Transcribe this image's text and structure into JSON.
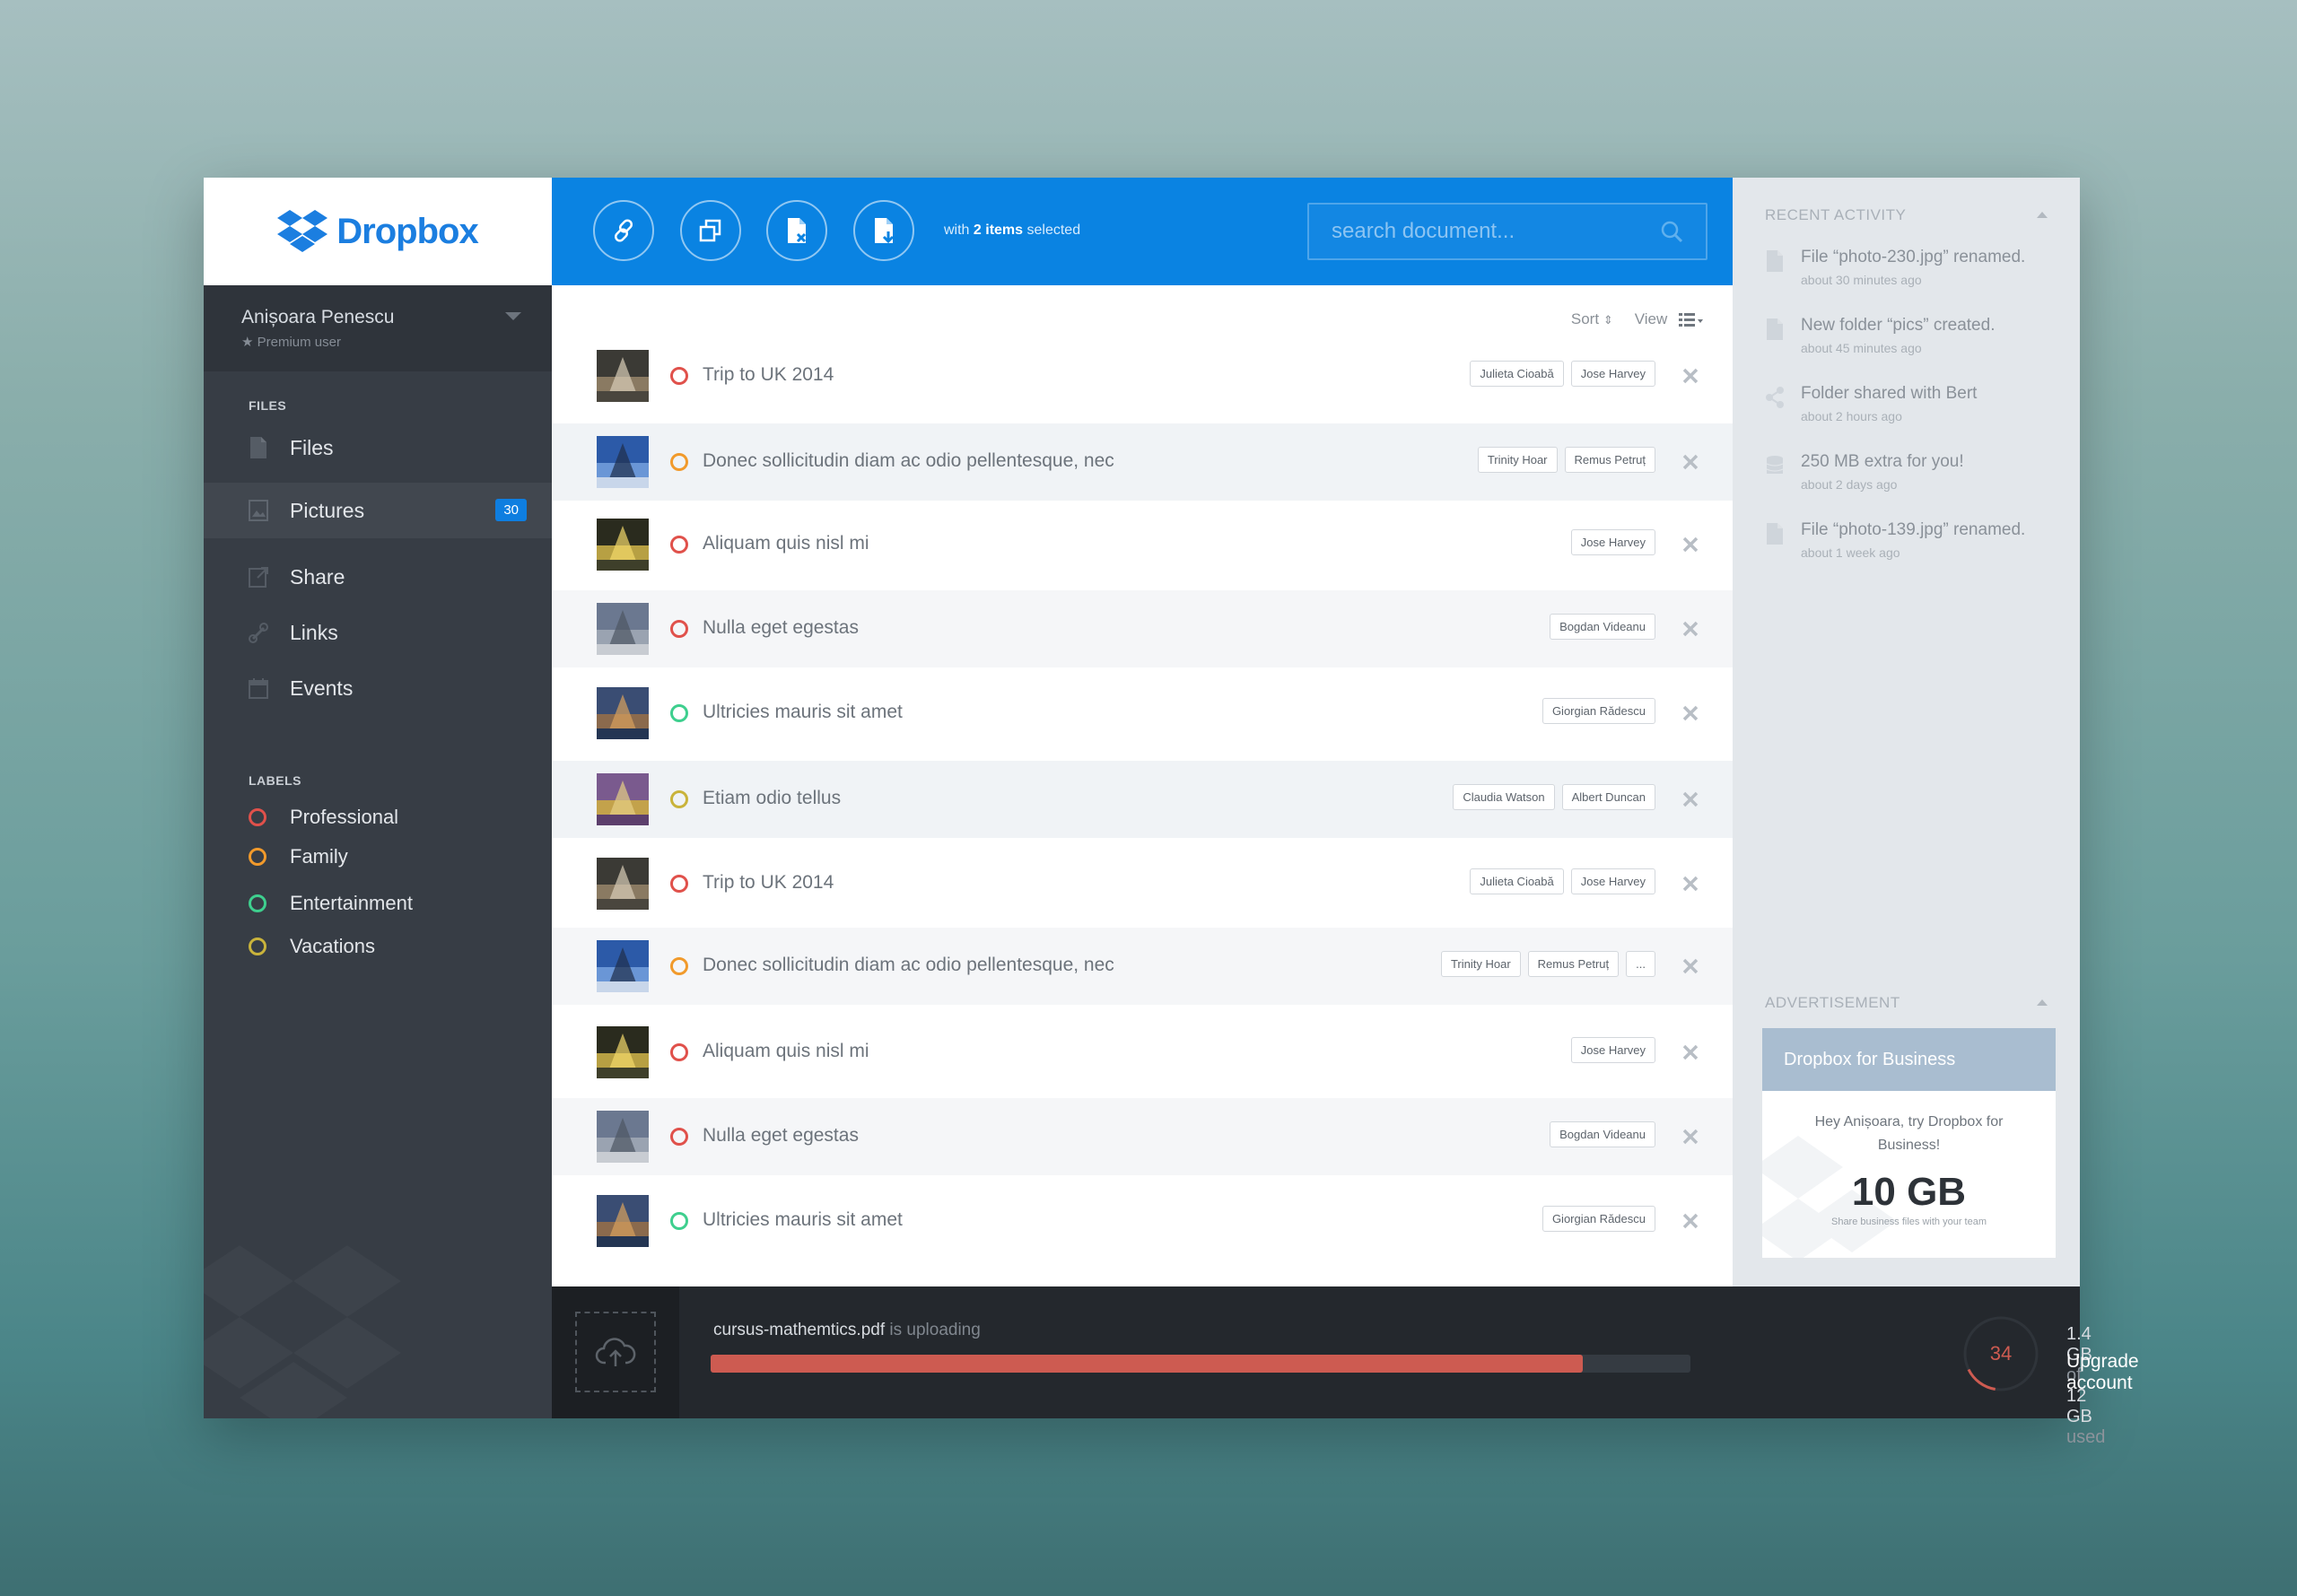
{
  "brand": {
    "name": "Dropbox",
    "color": "#1b7ee0"
  },
  "user": {
    "name": "Anișoara Penescu",
    "role": "★ Premium user"
  },
  "sidebar": {
    "files_section": "FILES",
    "items": [
      {
        "label": "Files",
        "icon": "file-icon"
      },
      {
        "label": "Pictures",
        "icon": "picture-icon",
        "badge": "30"
      },
      {
        "label": "Share",
        "icon": "share-icon"
      },
      {
        "label": "Links",
        "icon": "link-icon"
      },
      {
        "label": "Events",
        "icon": "calendar-icon"
      }
    ],
    "labels_section": "LABELS",
    "labels": [
      {
        "label": "Professional",
        "color": "#e0514b"
      },
      {
        "label": "Family",
        "color": "#f19a2b"
      },
      {
        "label": "Entertainment",
        "color": "#3ecf8e"
      },
      {
        "label": "Vacations",
        "color": "#c9b33b"
      }
    ]
  },
  "toolbar": {
    "buttons": [
      "link-icon",
      "copy-icon",
      "delete-file-icon",
      "download-file-icon"
    ],
    "selection_prefix": "with",
    "selection_count": "2 items",
    "selection_suffix": "selected",
    "search_placeholder": "search document..."
  },
  "list": {
    "sort_label": "Sort",
    "view_label": "View",
    "rows": [
      {
        "title": "Trip to UK 2014",
        "ring": "#e0514b",
        "tags": [
          "Julieta Cioabă",
          "Jose Harvey"
        ],
        "thumb": "street"
      },
      {
        "title": "Donec sollicitudin diam ac odio pellentesque, nec",
        "ring": "#f19a2b",
        "tags": [
          "Trinity Hoar",
          "Remus Petruț"
        ],
        "thumb": "eiffel"
      },
      {
        "title": "Aliquam quis nisl mi",
        "ring": "#e0514b",
        "tags": [
          "Jose Harvey"
        ],
        "thumb": "night"
      },
      {
        "title": "Nulla eget egestas",
        "ring": "#e0514b",
        "tags": [
          "Bogdan Videanu"
        ],
        "thumb": "cathedral"
      },
      {
        "title": "Ultricies mauris sit amet",
        "ring": "#3ecf8e",
        "tags": [
          "Giorgian Rădescu"
        ],
        "thumb": "city"
      },
      {
        "title": "Etiam odio tellus",
        "ring": "#c9b33b",
        "tags": [
          "Claudia Watson",
          "Albert Duncan"
        ],
        "thumb": "flowers"
      },
      {
        "title": "Trip to UK 2014",
        "ring": "#e0514b",
        "tags": [
          "Julieta Cioabă",
          "Jose Harvey"
        ],
        "thumb": "street"
      },
      {
        "title": "Donec sollicitudin diam ac odio pellentesque, nec",
        "ring": "#f19a2b",
        "tags": [
          "Trinity Hoar",
          "Remus Petruț",
          "..."
        ],
        "thumb": "eiffel"
      },
      {
        "title": "Aliquam quis nisl mi",
        "ring": "#e0514b",
        "tags": [
          "Jose Harvey"
        ],
        "thumb": "night"
      },
      {
        "title": "Nulla eget egestas",
        "ring": "#e0514b",
        "tags": [
          "Bogdan Videanu"
        ],
        "thumb": "cathedral"
      },
      {
        "title": "Ultricies mauris sit amet",
        "ring": "#3ecf8e",
        "tags": [
          "Giorgian Rădescu"
        ],
        "thumb": "city"
      }
    ]
  },
  "upload": {
    "filename": "cursus-mathemtics.pdf",
    "status": "is uploading",
    "progress": 0.89
  },
  "storage": {
    "gauge_value": "34",
    "used": "1.4 GB",
    "of": "of",
    "total": "12 GB",
    "suffix": "used",
    "upgrade_label": "Upgrade account"
  },
  "recent_activity": {
    "heading": "RECENT ACTIVITY",
    "items": [
      {
        "title": "File “photo-230.jpg” renamed.",
        "time": "about 30 minutes ago",
        "icon": "file-icon"
      },
      {
        "title": "New folder “pics” created.",
        "time": "about 45 minutes ago",
        "icon": "folder-icon"
      },
      {
        "title": "Folder shared with Bert",
        "time": "about 2 hours ago",
        "icon": "share-icon"
      },
      {
        "title": "250 MB extra for you!",
        "time": "about 2 days ago",
        "icon": "storage-icon"
      },
      {
        "title": "File “photo-139.jpg” renamed.",
        "time": "about 1 week ago",
        "icon": "file-icon"
      }
    ]
  },
  "advertisement": {
    "heading": "ADVERTISEMENT",
    "title": "Dropbox for Business",
    "message": "Hey Anișoara, try Dropbox for Business!",
    "big": "10 GB",
    "sub": "Share business files with your team"
  }
}
